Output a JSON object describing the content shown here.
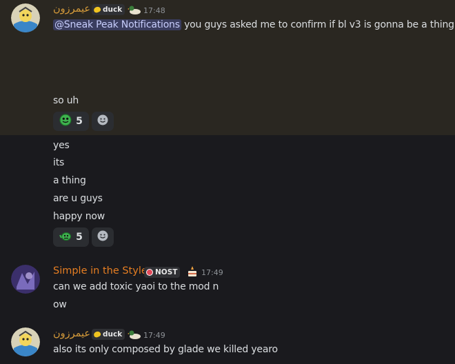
{
  "messages": [
    {
      "author": "عيمرزون",
      "author_color": "#d49a3a",
      "tag": "duck",
      "time": "17:48",
      "mention": "@Sneak Peak Notifications",
      "first_line": " you guys asked me to confirm if bl v3 is gonna be a thing",
      "line2": "so uh",
      "reaction1": {
        "emoji": "green-smile-emoji",
        "count": "5"
      },
      "followups": [
        "yes",
        "its",
        "a thing",
        "are u guys",
        "happy now"
      ],
      "reaction2": {
        "emoji": "green-grumpy-emoji",
        "count": "5"
      }
    },
    {
      "author": "Simple in the Style",
      "author_color": "#e67e22",
      "tag": "NOST",
      "time": "17:49",
      "lines": [
        "can we add toxic yaoi to the mod n",
        "ow"
      ]
    },
    {
      "author": "عيمرزون",
      "author_color": "#d49a3a",
      "tag": "duck",
      "time": "17:49",
      "lines": [
        "also its only composed by glade we killed yearo"
      ]
    }
  ],
  "colors": {
    "highlight": "#2a2721",
    "background": "#1a1a1e",
    "mention_bg": "#3a3d5f"
  }
}
